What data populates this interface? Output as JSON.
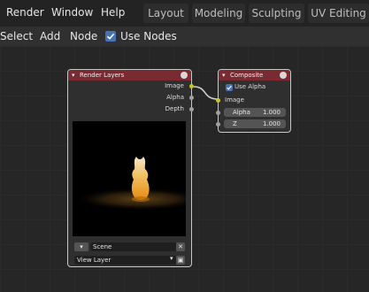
{
  "menu": {
    "render": "Render",
    "window": "Window",
    "help": "Help"
  },
  "workspace_tabs": [
    "Layout",
    "Modeling",
    "Sculpting",
    "UV Editing"
  ],
  "header": {
    "select": "Select",
    "add": "Add",
    "node": "Node",
    "use_nodes_label": "Use Nodes",
    "use_nodes_checked": true
  },
  "render_layers": {
    "title": "Render Layers",
    "outputs": [
      "Image",
      "Alpha",
      "Depth"
    ],
    "scene": "Scene",
    "view_layer": "View Layer"
  },
  "composite": {
    "title": "Composite",
    "use_alpha_label": "Use Alpha",
    "use_alpha_checked": true,
    "input_image": "Image",
    "alpha_label": "Alpha",
    "alpha_value": "1.000",
    "z_label": "Z",
    "z_value": "1.000"
  },
  "colors": {
    "node_header": "#7a2a31",
    "accent_blue": "#4772b3",
    "socket_yellow": "#c7c729",
    "socket_gray": "#a1a1a1"
  }
}
